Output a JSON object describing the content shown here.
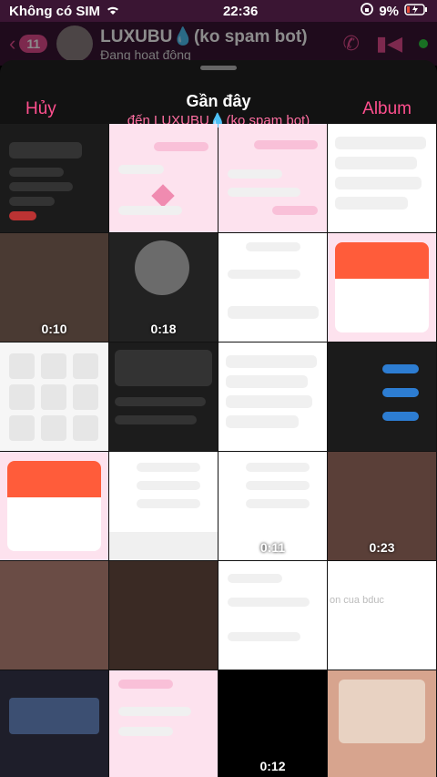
{
  "status": {
    "carrier": "Không có SIM",
    "time": "22:36",
    "battery": "9%"
  },
  "chat": {
    "back_count": "11",
    "name": "LUXUBU💧(ko spam bot)",
    "presence": "Đang hoạt động"
  },
  "sheet": {
    "cancel": "Hủy",
    "title": "Gần đây",
    "subtitle": "đến LUXUBU💧(ko spam bot)",
    "album": "Album"
  },
  "grid": [
    {
      "kind": "screenshot-dark"
    },
    {
      "kind": "pink-chat"
    },
    {
      "kind": "pink-chat"
    },
    {
      "kind": "white-list"
    },
    {
      "kind": "video",
      "duration": "0:10"
    },
    {
      "kind": "video",
      "duration": "0:18"
    },
    {
      "kind": "white-profile"
    },
    {
      "kind": "message-card"
    },
    {
      "kind": "tiles"
    },
    {
      "kind": "dark-stories"
    },
    {
      "kind": "white-list"
    },
    {
      "kind": "dark-requests"
    },
    {
      "kind": "message-card"
    },
    {
      "kind": "voice-keyboard"
    },
    {
      "kind": "video",
      "duration": "0:11"
    },
    {
      "kind": "video",
      "duration": "0:23"
    },
    {
      "kind": "photo"
    },
    {
      "kind": "photo"
    },
    {
      "kind": "white-voice"
    },
    {
      "kind": "text-fragment",
      "text": "on cua bduc"
    },
    {
      "kind": "game"
    },
    {
      "kind": "pink-chat"
    },
    {
      "kind": "video",
      "duration": "0:12"
    },
    {
      "kind": "game"
    }
  ]
}
